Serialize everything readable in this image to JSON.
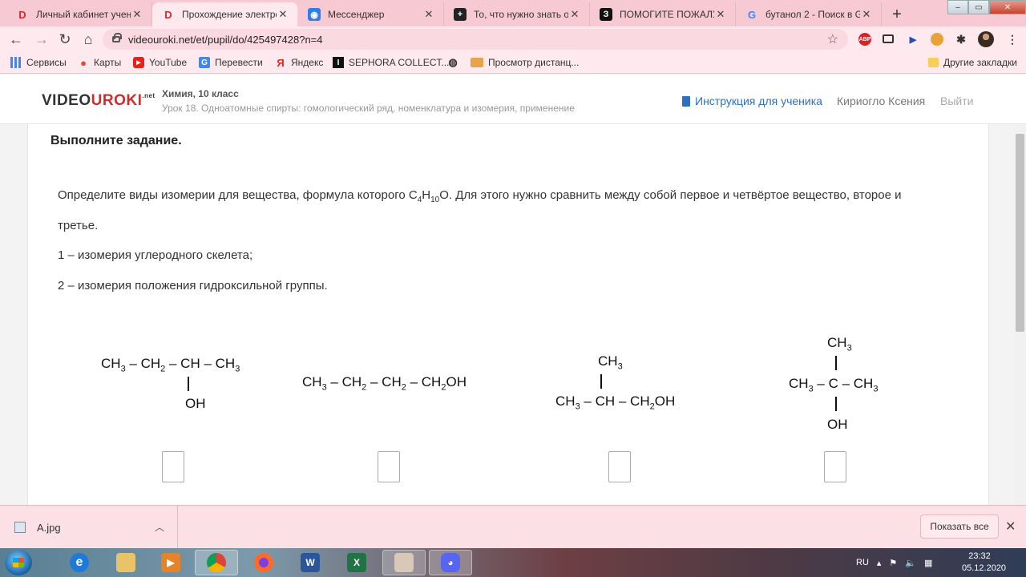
{
  "browser": {
    "tabs": [
      {
        "title": "Личный кабинет учени",
        "favicon": "videouroki-icon",
        "color": "#d32b2b",
        "glyph": "D",
        "active": false
      },
      {
        "title": "Прохождение электрон",
        "favicon": "videouroki-icon",
        "color": "#d32b2b",
        "glyph": "D",
        "active": true
      },
      {
        "title": "Мессенджер",
        "favicon": "messenger-icon",
        "color": "#2f7ee6",
        "glyph": "◉",
        "active": false
      },
      {
        "title": "То, что нужно знать о",
        "favicon": "plus-icon",
        "color": "#222222",
        "glyph": "+",
        "active": false
      },
      {
        "title": "ПОМОГИТЕ ПОЖАЛУС",
        "favicon": "znanija-icon",
        "color": "#111111",
        "glyph": "З",
        "active": false
      },
      {
        "title": "бутанол 2 - Поиск в Go",
        "favicon": "google-icon",
        "color": "#4285f4",
        "glyph": "G",
        "active": false
      }
    ],
    "url": "videouroki.net/et/pupil/do/425497428?n=4",
    "bookmarks": [
      {
        "label": "Сервисы",
        "icon": "apps-grid-icon"
      },
      {
        "label": "Карты",
        "icon": "maps-pin-icon"
      },
      {
        "label": "YouTube",
        "icon": "youtube-icon"
      },
      {
        "label": "Перевести",
        "icon": "translate-icon"
      },
      {
        "label": "Яндекс",
        "icon": "yandex-icon"
      },
      {
        "label": "SEPHORA COLLECT...",
        "icon": "sephora-icon"
      },
      {
        "label": "",
        "icon": "globe-icon"
      },
      {
        "label": "Просмотр дистанц...",
        "icon": "folder-icon"
      }
    ],
    "other_bookmarks": "Другие закладки"
  },
  "site": {
    "logo_prefix": "VIDEO",
    "logo_suffix": "UROKI",
    "logo_tld": ".net",
    "course": "Химия, 10 класс",
    "lesson": "Урок 18. Одноатомные спирты: гомологический ряд, номенклатура и изомерия, применение",
    "instructions": "Инструкция для ученика",
    "user": "Кириогло Ксения",
    "logout": "Выйти"
  },
  "task": {
    "heading": "Выполните задание.",
    "question_line1": "Определите виды изомерии для вещества, формула которого C",
    "question_line1_sub1": "4",
    "question_line1_mid": "H",
    "question_line1_sub2": "10",
    "question_line1_end": "O. Для этого нужно сравнить между собой первое и четвёртое вещество, второе и",
    "question_line2": "третье.",
    "option1": "1 – изомерия углеродного скелета;",
    "option2": "2 – изомерия положения гидроксильной группы."
  },
  "downloads": {
    "file": "A.jpg",
    "show_all": "Показать все"
  },
  "taskbar": {
    "lang": "RU",
    "time": "23:32",
    "date": "05.12.2020"
  }
}
